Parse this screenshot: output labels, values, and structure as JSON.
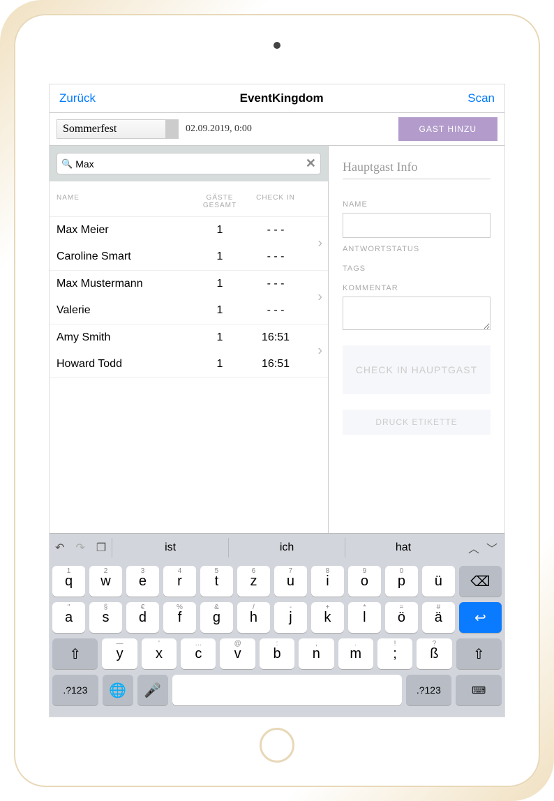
{
  "nav": {
    "back": "Zurück",
    "title": "EventKingdom",
    "scan": "Scan"
  },
  "toolbar": {
    "event": "Sommerfest",
    "date": "02.09.2019, 0:00",
    "add_guest": "GAST HINZU"
  },
  "search": {
    "value": "Max"
  },
  "table": {
    "headers": {
      "name": "NAME",
      "guests": "GÄSTE GESAMT",
      "checkin": "CHECK IN"
    },
    "groups": [
      {
        "rows": [
          {
            "name": "Max Meier",
            "guests": "1",
            "checkin": "- - -"
          },
          {
            "name": "Caroline Smart",
            "guests": "1",
            "checkin": "- - -"
          }
        ]
      },
      {
        "rows": [
          {
            "name": "Max Mustermann",
            "guests": "1",
            "checkin": "- - -"
          },
          {
            "name": "Valerie",
            "guests": "1",
            "checkin": "- - -"
          }
        ]
      },
      {
        "rows": [
          {
            "name": "Amy Smith",
            "guests": "1",
            "checkin": "16:51"
          },
          {
            "name": "Howard Todd",
            "guests": "1",
            "checkin": "16:51"
          }
        ]
      }
    ]
  },
  "detail": {
    "title": "Hauptgast Info",
    "labels": {
      "name": "NAME",
      "status": "ANTWORTSTATUS",
      "tags": "TAGS",
      "comment": "KOMMENTAR"
    },
    "checkin_btn": "CHECK IN HAUPTGAST",
    "print_btn": "DRUCK ETIKETTE"
  },
  "keyboard": {
    "suggestions": [
      "ist",
      "ich",
      "hat"
    ],
    "row1": [
      {
        "m": "q",
        "s": "1"
      },
      {
        "m": "w",
        "s": "2"
      },
      {
        "m": "e",
        "s": "3"
      },
      {
        "m": "r",
        "s": "4"
      },
      {
        "m": "t",
        "s": "5"
      },
      {
        "m": "z",
        "s": "6"
      },
      {
        "m": "u",
        "s": "7"
      },
      {
        "m": "i",
        "s": "8"
      },
      {
        "m": "o",
        "s": "9"
      },
      {
        "m": "p",
        "s": "0"
      },
      {
        "m": "ü",
        "s": ""
      }
    ],
    "row2": [
      {
        "m": "a",
        "s": "\""
      },
      {
        "m": "s",
        "s": "§"
      },
      {
        "m": "d",
        "s": "€"
      },
      {
        "m": "f",
        "s": "%"
      },
      {
        "m": "g",
        "s": "&"
      },
      {
        "m": "h",
        "s": "/"
      },
      {
        "m": "j",
        "s": "-"
      },
      {
        "m": "k",
        "s": "+"
      },
      {
        "m": "l",
        "s": "*"
      },
      {
        "m": "ö",
        "s": "="
      },
      {
        "m": "ä",
        "s": "#"
      }
    ],
    "row3": [
      {
        "m": "y",
        "s": "—"
      },
      {
        "m": "x",
        "s": "'"
      },
      {
        "m": "c",
        "s": "…"
      },
      {
        "m": "v",
        "s": "@"
      },
      {
        "m": "b",
        "s": ":"
      },
      {
        "m": "n",
        "s": ","
      },
      {
        "m": "m",
        "s": "."
      },
      {
        "m": ";",
        "s": "!"
      },
      {
        "m": "ß",
        "s": "?"
      }
    ],
    "numkey": ".?123"
  }
}
